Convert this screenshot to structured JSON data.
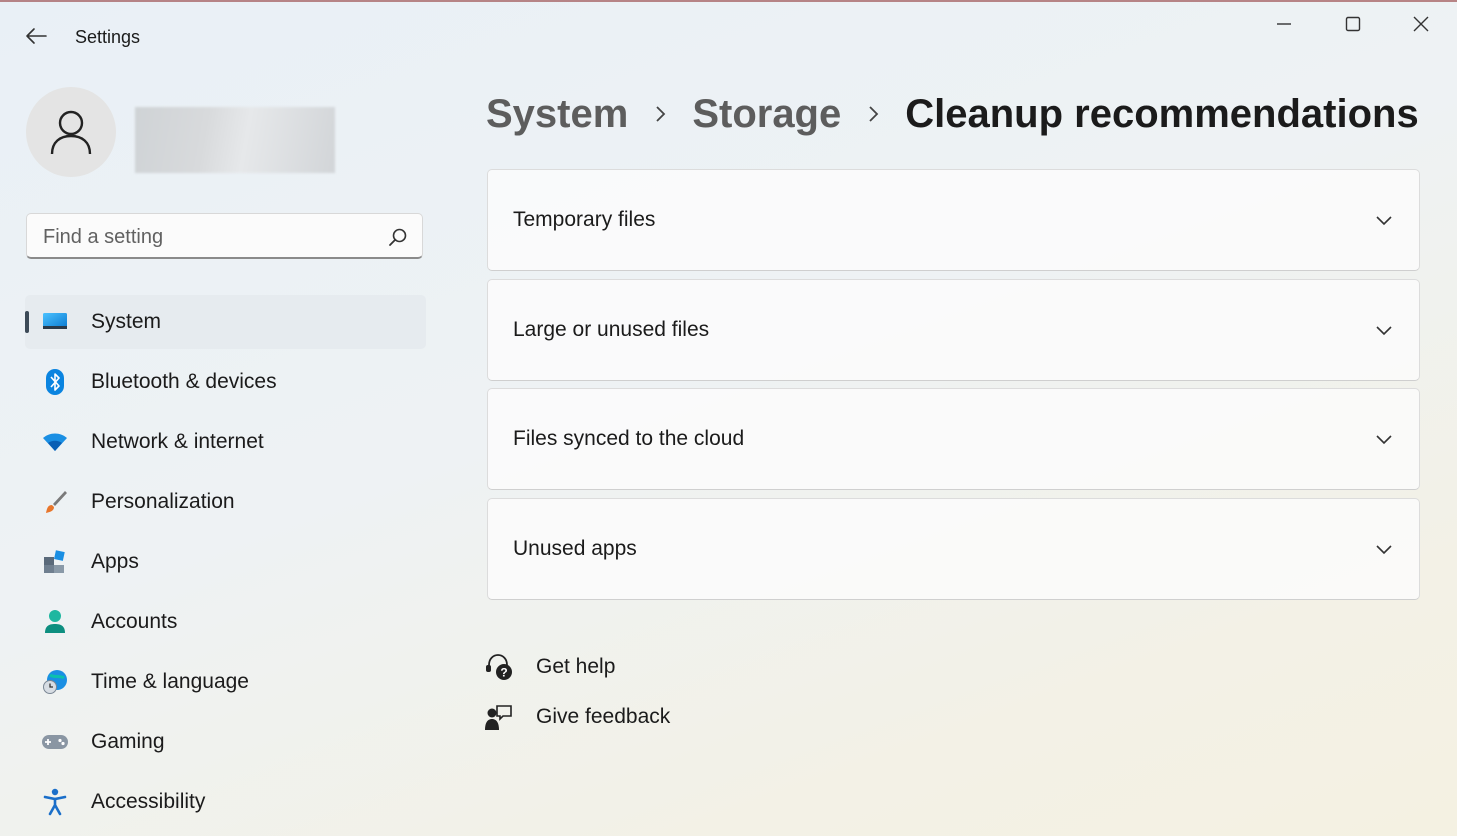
{
  "window": {
    "title": "Settings"
  },
  "search": {
    "placeholder": "Find a setting"
  },
  "sidebar": {
    "items": [
      {
        "label": "System",
        "icon": "system-icon",
        "selected": true
      },
      {
        "label": "Bluetooth & devices",
        "icon": "bluetooth-icon"
      },
      {
        "label": "Network & internet",
        "icon": "wifi-icon"
      },
      {
        "label": "Personalization",
        "icon": "paintbrush-icon"
      },
      {
        "label": "Apps",
        "icon": "apps-icon"
      },
      {
        "label": "Accounts",
        "icon": "person-icon"
      },
      {
        "label": "Time & language",
        "icon": "globe-clock-icon"
      },
      {
        "label": "Gaming",
        "icon": "gamepad-icon"
      },
      {
        "label": "Accessibility",
        "icon": "accessibility-icon"
      }
    ]
  },
  "breadcrumb": {
    "items": [
      "System",
      "Storage",
      "Cleanup recommendations"
    ]
  },
  "cards": [
    {
      "label": "Temporary files"
    },
    {
      "label": "Large or unused files"
    },
    {
      "label": "Files synced to the cloud"
    },
    {
      "label": "Unused apps"
    }
  ],
  "help": {
    "get_help": "Get help",
    "give_feedback": "Give feedback"
  },
  "colors": {
    "accent": "#0078d4",
    "selected_background": "#e6ebef",
    "indicator": "#3c4a57"
  }
}
